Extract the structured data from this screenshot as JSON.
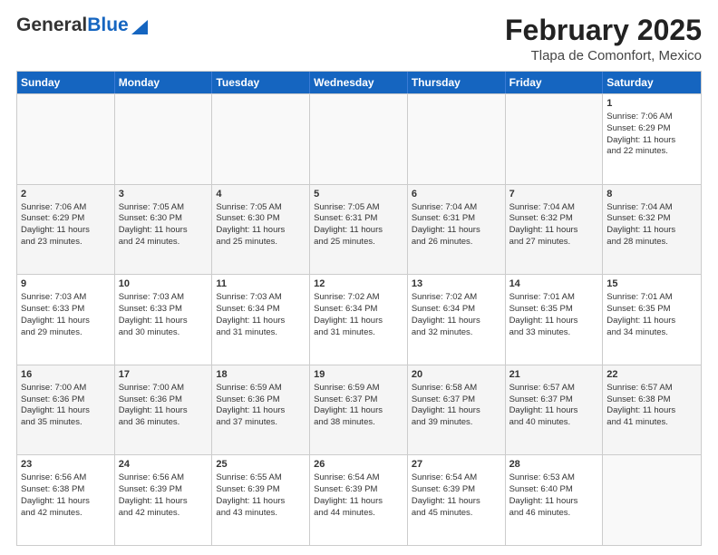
{
  "logo": {
    "general": "General",
    "blue": "Blue"
  },
  "title": "February 2025",
  "location": "Tlapa de Comonfort, Mexico",
  "weekdays": [
    "Sunday",
    "Monday",
    "Tuesday",
    "Wednesday",
    "Thursday",
    "Friday",
    "Saturday"
  ],
  "rows": [
    [
      {
        "day": "",
        "text": ""
      },
      {
        "day": "",
        "text": ""
      },
      {
        "day": "",
        "text": ""
      },
      {
        "day": "",
        "text": ""
      },
      {
        "day": "",
        "text": ""
      },
      {
        "day": "",
        "text": ""
      },
      {
        "day": "1",
        "text": "Sunrise: 7:06 AM\nSunset: 6:29 PM\nDaylight: 11 hours\nand 22 minutes."
      }
    ],
    [
      {
        "day": "2",
        "text": "Sunrise: 7:06 AM\nSunset: 6:29 PM\nDaylight: 11 hours\nand 23 minutes."
      },
      {
        "day": "3",
        "text": "Sunrise: 7:05 AM\nSunset: 6:30 PM\nDaylight: 11 hours\nand 24 minutes."
      },
      {
        "day": "4",
        "text": "Sunrise: 7:05 AM\nSunset: 6:30 PM\nDaylight: 11 hours\nand 25 minutes."
      },
      {
        "day": "5",
        "text": "Sunrise: 7:05 AM\nSunset: 6:31 PM\nDaylight: 11 hours\nand 25 minutes."
      },
      {
        "day": "6",
        "text": "Sunrise: 7:04 AM\nSunset: 6:31 PM\nDaylight: 11 hours\nand 26 minutes."
      },
      {
        "day": "7",
        "text": "Sunrise: 7:04 AM\nSunset: 6:32 PM\nDaylight: 11 hours\nand 27 minutes."
      },
      {
        "day": "8",
        "text": "Sunrise: 7:04 AM\nSunset: 6:32 PM\nDaylight: 11 hours\nand 28 minutes."
      }
    ],
    [
      {
        "day": "9",
        "text": "Sunrise: 7:03 AM\nSunset: 6:33 PM\nDaylight: 11 hours\nand 29 minutes."
      },
      {
        "day": "10",
        "text": "Sunrise: 7:03 AM\nSunset: 6:33 PM\nDaylight: 11 hours\nand 30 minutes."
      },
      {
        "day": "11",
        "text": "Sunrise: 7:03 AM\nSunset: 6:34 PM\nDaylight: 11 hours\nand 31 minutes."
      },
      {
        "day": "12",
        "text": "Sunrise: 7:02 AM\nSunset: 6:34 PM\nDaylight: 11 hours\nand 31 minutes."
      },
      {
        "day": "13",
        "text": "Sunrise: 7:02 AM\nSunset: 6:34 PM\nDaylight: 11 hours\nand 32 minutes."
      },
      {
        "day": "14",
        "text": "Sunrise: 7:01 AM\nSunset: 6:35 PM\nDaylight: 11 hours\nand 33 minutes."
      },
      {
        "day": "15",
        "text": "Sunrise: 7:01 AM\nSunset: 6:35 PM\nDaylight: 11 hours\nand 34 minutes."
      }
    ],
    [
      {
        "day": "16",
        "text": "Sunrise: 7:00 AM\nSunset: 6:36 PM\nDaylight: 11 hours\nand 35 minutes."
      },
      {
        "day": "17",
        "text": "Sunrise: 7:00 AM\nSunset: 6:36 PM\nDaylight: 11 hours\nand 36 minutes."
      },
      {
        "day": "18",
        "text": "Sunrise: 6:59 AM\nSunset: 6:36 PM\nDaylight: 11 hours\nand 37 minutes."
      },
      {
        "day": "19",
        "text": "Sunrise: 6:59 AM\nSunset: 6:37 PM\nDaylight: 11 hours\nand 38 minutes."
      },
      {
        "day": "20",
        "text": "Sunrise: 6:58 AM\nSunset: 6:37 PM\nDaylight: 11 hours\nand 39 minutes."
      },
      {
        "day": "21",
        "text": "Sunrise: 6:57 AM\nSunset: 6:37 PM\nDaylight: 11 hours\nand 40 minutes."
      },
      {
        "day": "22",
        "text": "Sunrise: 6:57 AM\nSunset: 6:38 PM\nDaylight: 11 hours\nand 41 minutes."
      }
    ],
    [
      {
        "day": "23",
        "text": "Sunrise: 6:56 AM\nSunset: 6:38 PM\nDaylight: 11 hours\nand 42 minutes."
      },
      {
        "day": "24",
        "text": "Sunrise: 6:56 AM\nSunset: 6:39 PM\nDaylight: 11 hours\nand 42 minutes."
      },
      {
        "day": "25",
        "text": "Sunrise: 6:55 AM\nSunset: 6:39 PM\nDaylight: 11 hours\nand 43 minutes."
      },
      {
        "day": "26",
        "text": "Sunrise: 6:54 AM\nSunset: 6:39 PM\nDaylight: 11 hours\nand 44 minutes."
      },
      {
        "day": "27",
        "text": "Sunrise: 6:54 AM\nSunset: 6:39 PM\nDaylight: 11 hours\nand 45 minutes."
      },
      {
        "day": "28",
        "text": "Sunrise: 6:53 AM\nSunset: 6:40 PM\nDaylight: 11 hours\nand 46 minutes."
      },
      {
        "day": "",
        "text": ""
      }
    ]
  ]
}
